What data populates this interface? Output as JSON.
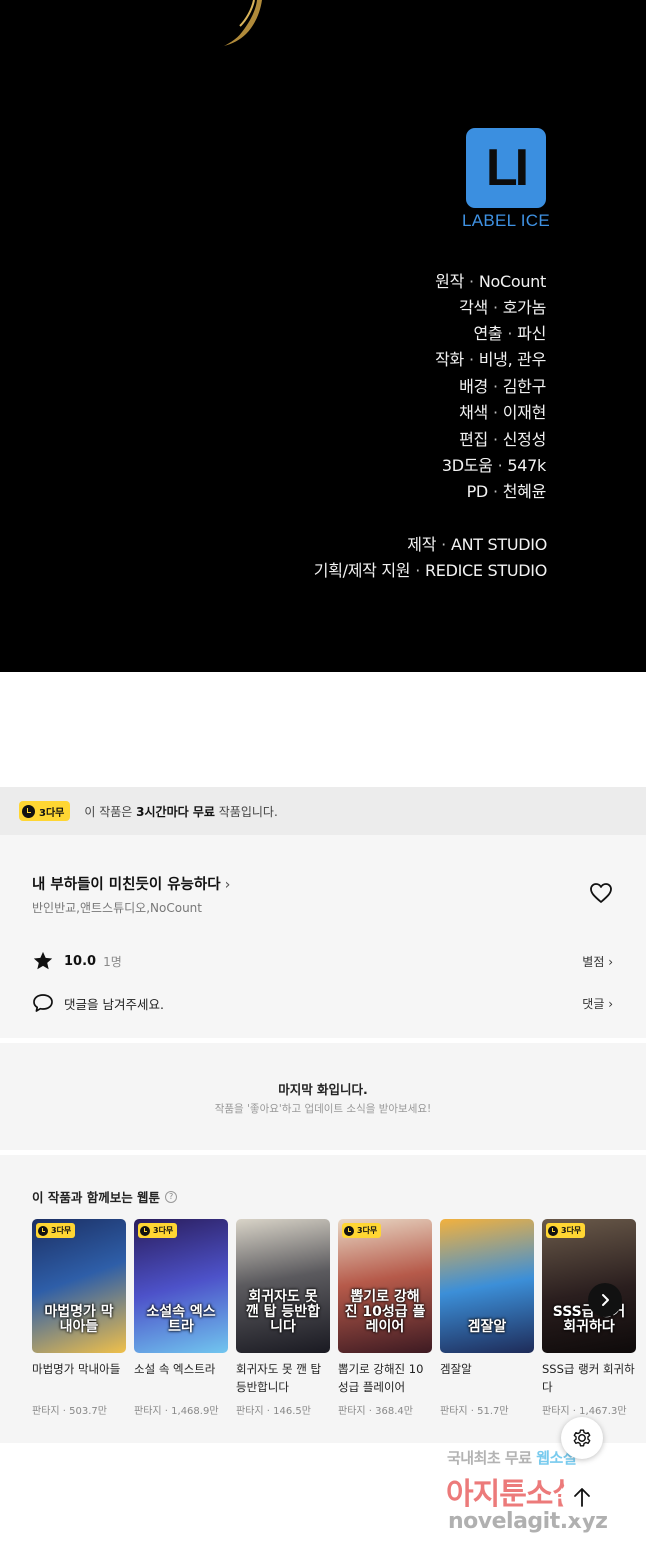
{
  "credits": {
    "logo_letters": "LI",
    "logo_name": "LABEL ICE",
    "lines": [
      {
        "role": "원작",
        "name": "NoCount"
      },
      {
        "role": "각색",
        "name": "호가놈"
      },
      {
        "role": "연출",
        "name": "파신"
      },
      {
        "role": "작화",
        "name": "비냉, 관우"
      },
      {
        "role": "배경",
        "name": "김한구"
      },
      {
        "role": "채색",
        "name": "이재현"
      },
      {
        "role": "편집",
        "name": "신정성"
      },
      {
        "role": "3D도움",
        "name": "547k"
      },
      {
        "role": "PD",
        "name": "천혜윤"
      }
    ],
    "studio_lines": [
      {
        "role": "제작",
        "name": "ANT STUDIO"
      },
      {
        "role": "기획/제작 지원",
        "name": "REDICE STUDIO"
      }
    ],
    "separator": "·"
  },
  "free_banner": {
    "badge": "3다무",
    "text_prefix": "이 작품은 ",
    "text_bold": "3시간마다 무료",
    "text_suffix": " 작품입니다."
  },
  "series": {
    "title": "내 부하들이 미친듯이 유능하다",
    "title_chevron": "›",
    "authors": "반인반교,앤트스튜디오,NoCount",
    "rating": "10.0",
    "rating_count": "1명",
    "rate_link": "별점 ›",
    "comment_placeholder": "댓글을 남겨주세요.",
    "comment_link": "댓글 ›"
  },
  "last_episode": {
    "title": "마지막 화입니다.",
    "subtitle": "작품을 '좋아요'하고 업데이트 소식을 받아보세요!"
  },
  "recommendations": {
    "title": "이 작품과 함께보는 웹툰",
    "help": "?",
    "items": [
      {
        "name": "마법명가 막내아들",
        "genre": "판타지",
        "views": "503.7만",
        "badge": "3다무",
        "cover_text": "마법명가 막내아들",
        "bg": "linear-gradient(160deg,#1c2f63 0%,#2e5ea8 45%,#f0c04a 100%)"
      },
      {
        "name": "소설 속 엑스트라",
        "genre": "판타지",
        "views": "1,468.9만",
        "badge": "3다무",
        "cover_text": "소설속 엑스트라",
        "bg": "linear-gradient(165deg,#2a1d5c 0%,#4d52c9 50%,#71c6ef 100%)"
      },
      {
        "name": "회귀자도 못 깬 탑 등반합니다",
        "genre": "판타지",
        "views": "146.5만",
        "badge": "",
        "cover_text": "회귀자도 못 깬 탑 등반합니다",
        "bg": "linear-gradient(170deg,#d9d4c8 0%,#5b5a5e 45%,#1a1a22 100%)"
      },
      {
        "name": "뽑기로 강해진 10성급 플레이어",
        "genre": "판타지",
        "views": "368.4만",
        "badge": "3다무",
        "cover_text": "뽑기로 강해진 10성급 플레이어",
        "bg": "linear-gradient(170deg,#e8d7c4 0%,#b65a4a 45%,#3d1a22 100%)"
      },
      {
        "name": "겜잘알",
        "genre": "판타지",
        "views": "51.7만",
        "badge": "",
        "cover_text": "겜잘알",
        "bg": "linear-gradient(170deg,#f2b13e 0%,#3c8fd8 50%,#1e2b58 100%)"
      },
      {
        "name": "SSS급 랭커 회귀하다",
        "genre": "판타지",
        "views": "1,467.3만",
        "badge": "3다무",
        "cover_text": "SSS급 랭커 회귀하다",
        "bg": "linear-gradient(170deg,#6a5a4a 0%,#2a1e1e 55%,#0e0a0a 100%)"
      }
    ],
    "meta_sep": " · "
  },
  "watermark": {
    "line1_a": "국내최초 무료 ",
    "line1_b": "웹소설",
    "line2": "아지툰소설",
    "line3": "novelagit.xyz"
  },
  "colors": {
    "badge_yellow": "#ffd633",
    "logo_blue": "#3b8fe0"
  },
  "icons": [
    "gear-icon",
    "arrow-up-icon",
    "heart-icon",
    "star-icon",
    "comment-icon",
    "chevron-right-icon",
    "clock-icon"
  ]
}
